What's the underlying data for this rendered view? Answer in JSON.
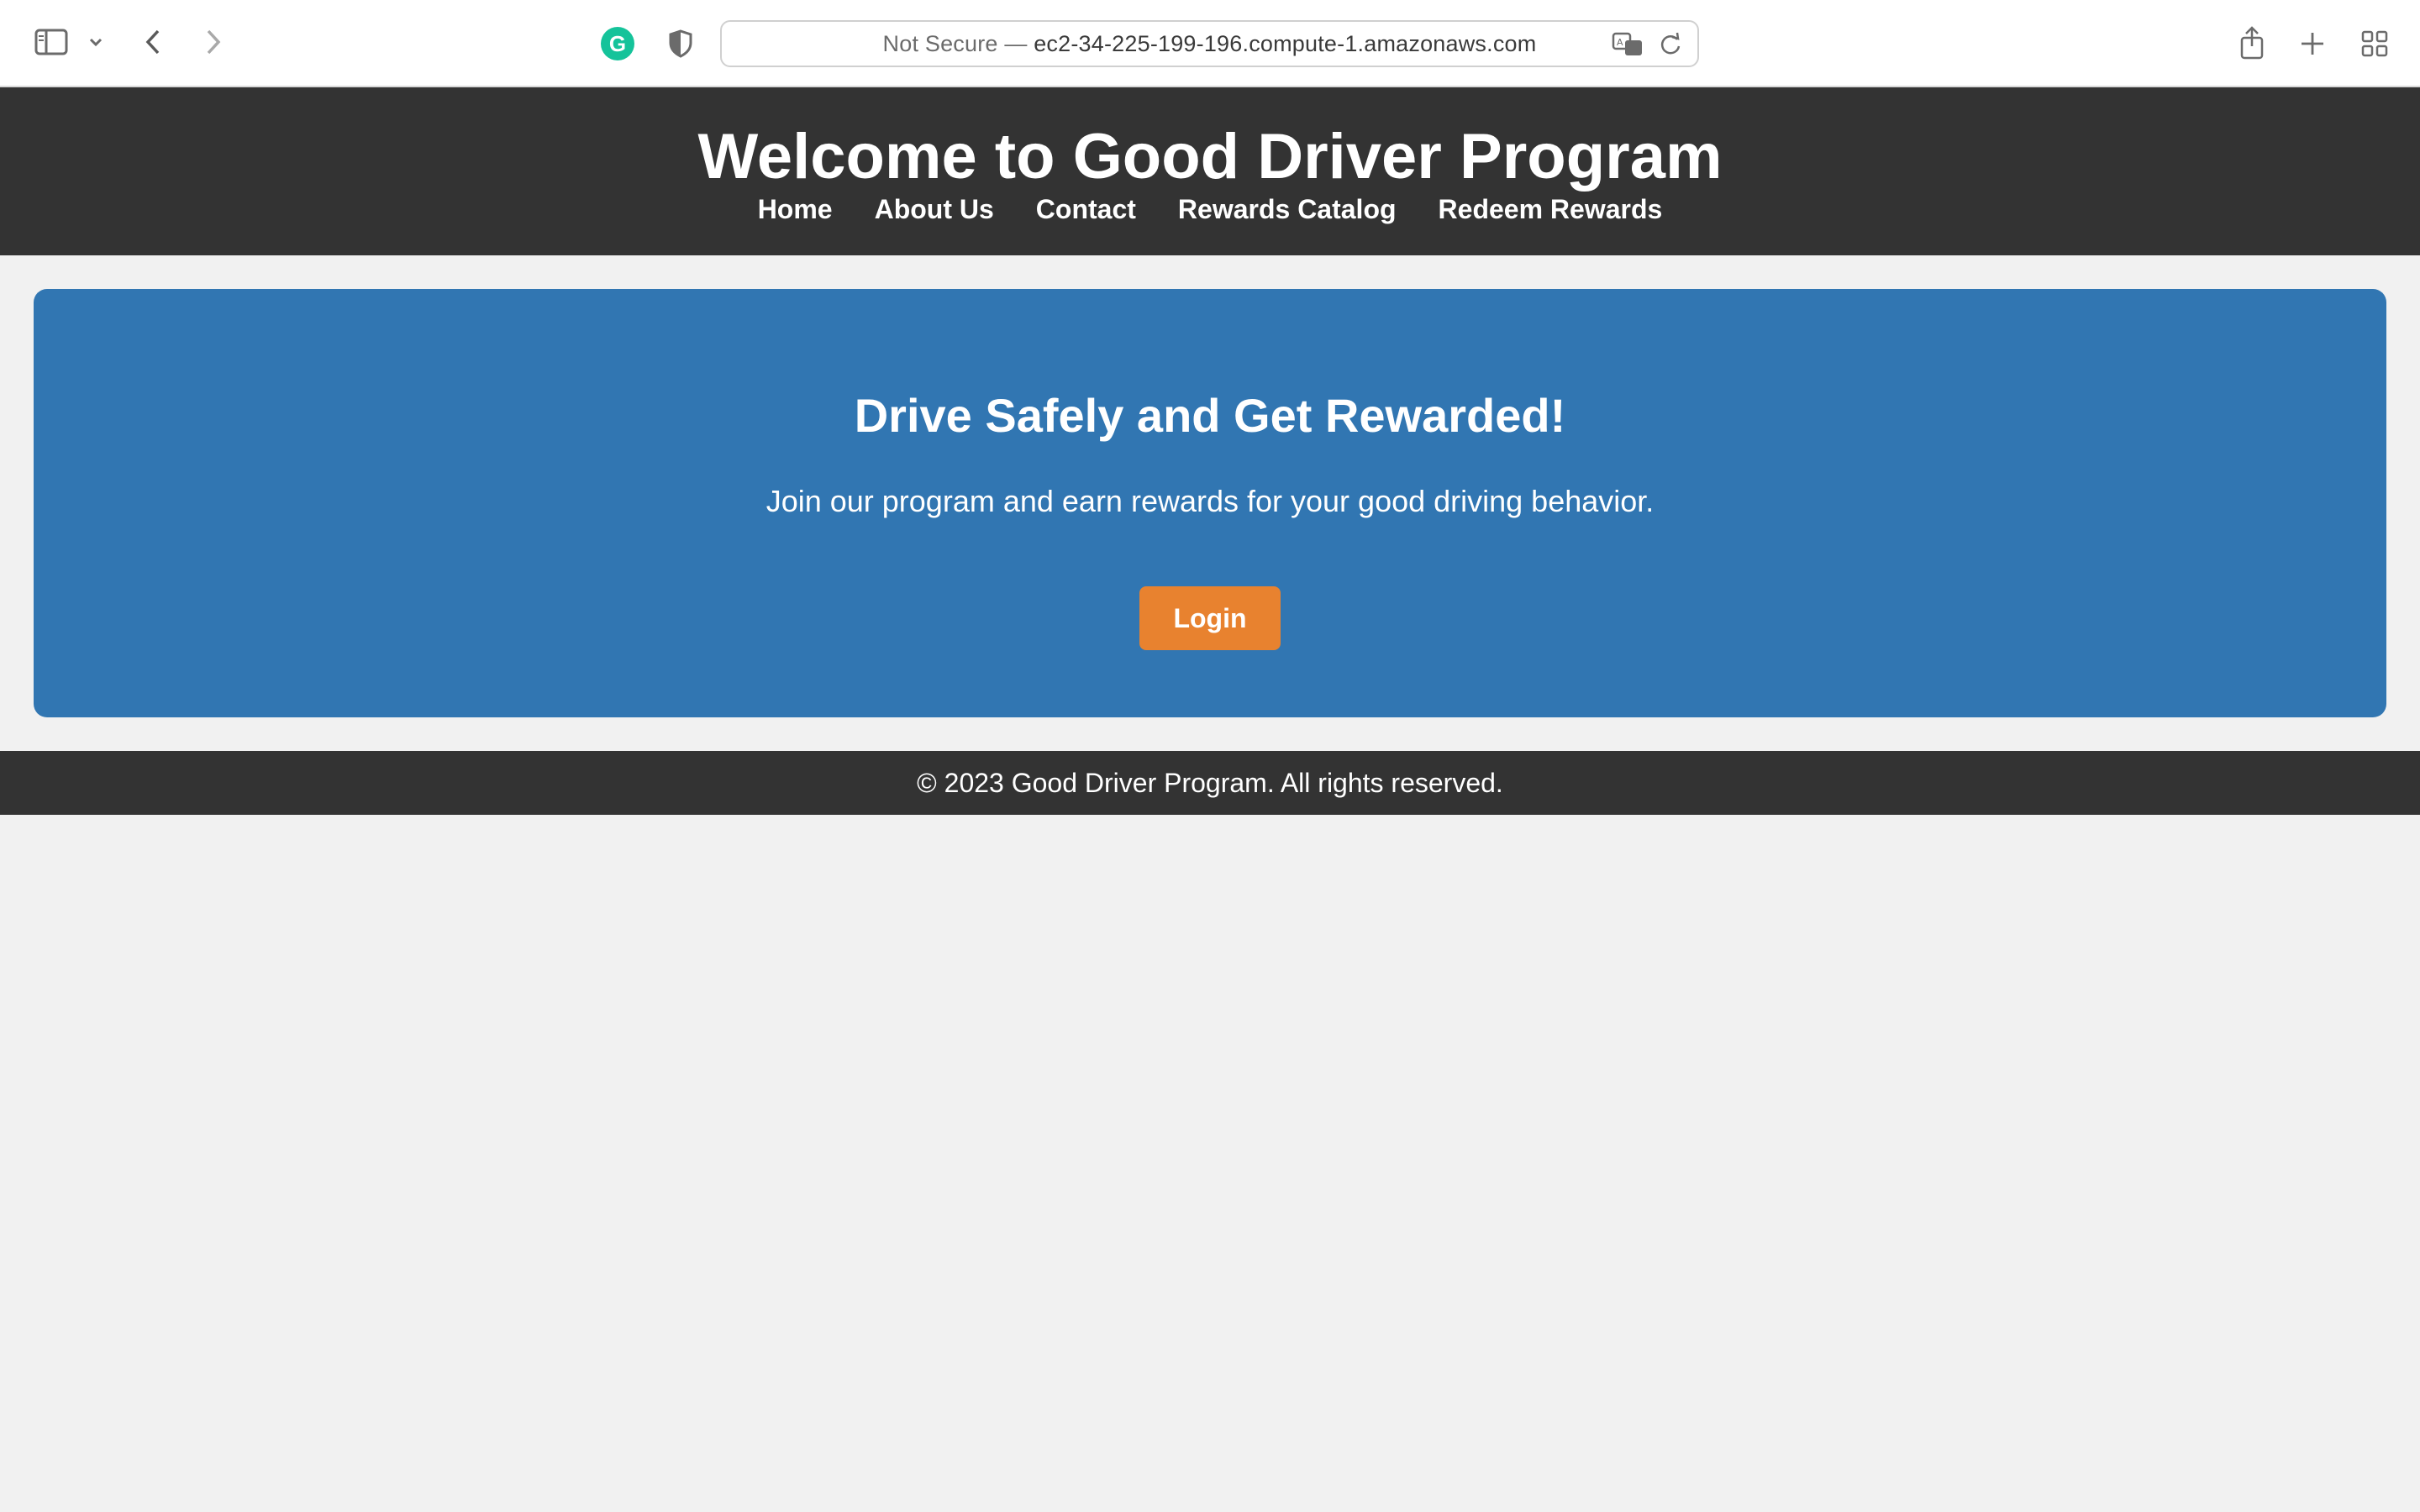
{
  "browser": {
    "address_prefix": "Not Secure —",
    "address_host": "ec2-34-225-199-196.compute-1.amazonaws.com",
    "grammarly_letter": "G"
  },
  "header": {
    "title": "Welcome to Good Driver Program",
    "nav": [
      "Home",
      "About Us",
      "Contact",
      "Rewards Catalog",
      "Redeem Rewards"
    ]
  },
  "hero": {
    "heading": "Drive Safely and Get Rewarded!",
    "text": "Join our program and earn rewards for your good driving behavior.",
    "button": "Login"
  },
  "footer": {
    "text": "© 2023 Good Driver Program. All rights reserved."
  },
  "colors": {
    "header_bg": "#333333",
    "hero_bg": "#3176b2",
    "button_bg": "#e8822f",
    "page_bg": "#f1f1f1"
  }
}
